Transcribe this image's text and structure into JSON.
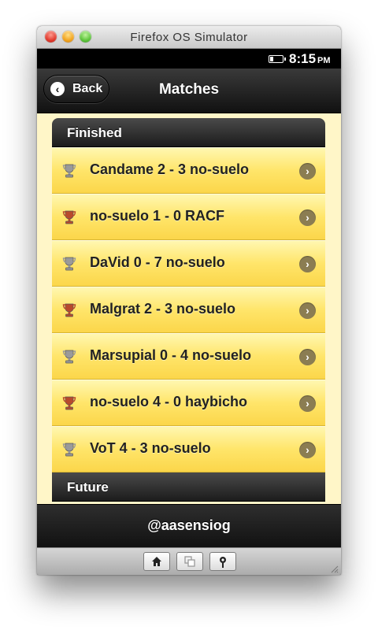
{
  "window": {
    "title": "Firefox OS Simulator"
  },
  "status": {
    "time": "8:15",
    "ampm": "PM",
    "battery_level": 0.3
  },
  "header": {
    "back_label": "Back",
    "title": "Matches"
  },
  "sections": [
    {
      "title": "Finished"
    },
    {
      "title": "Future"
    }
  ],
  "matches": [
    {
      "text": "Candame 2 - 3 no-suelo",
      "trophy": "silver"
    },
    {
      "text": "no-suelo 1 - 0 RACF",
      "trophy": "bronze"
    },
    {
      "text": "DaVid 0 - 7 no-suelo",
      "trophy": "silver"
    },
    {
      "text": "Malgrat 2 - 3 no-suelo",
      "trophy": "bronze"
    },
    {
      "text": "Marsupial 0 - 4 no-suelo",
      "trophy": "silver"
    },
    {
      "text": "no-suelo 4 - 0 haybicho",
      "trophy": "bronze"
    },
    {
      "text": "VoT 4 - 3 no-suelo",
      "trophy": "silver"
    }
  ],
  "footer": {
    "text": "@aasensiog"
  },
  "toolbar": {
    "buttons": [
      "home-icon",
      "windows-icon",
      "location-pin-icon"
    ]
  },
  "colors": {
    "row_top": "#fff7b0",
    "row_bottom": "#fbd64a",
    "background": "#fff6c8",
    "silver_trophy": "#9a9a9a",
    "bronze_trophy": "#b84a2c"
  }
}
